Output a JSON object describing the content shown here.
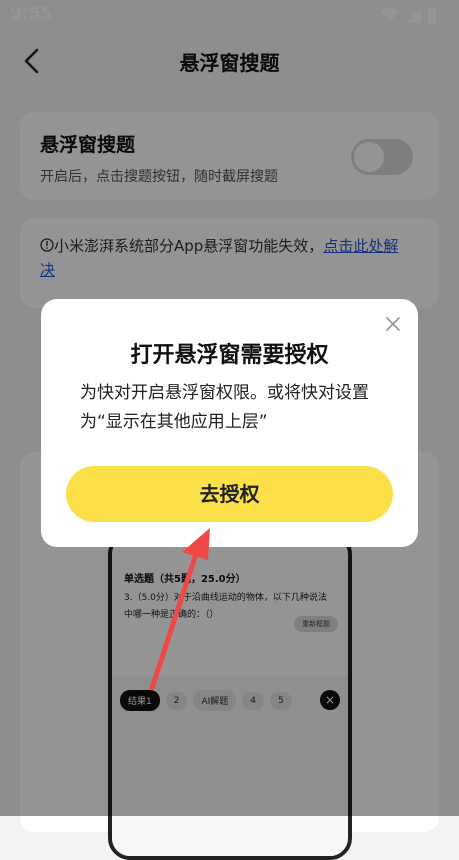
{
  "status": {
    "time": "9:55"
  },
  "header": {
    "title": "悬浮窗搜题"
  },
  "float_card": {
    "title": "悬浮窗搜题",
    "subtitle": "开启后，点击搜题按钮，随时截屏搜题",
    "enabled": false
  },
  "notice": {
    "text": "小米澎湃系统部分App悬浮窗功能失效，",
    "link": "点击此处解决"
  },
  "preview": {
    "heading": "单选题（共5题，25.0分）",
    "question": "3.（5.0分）对于沿曲线运动的物体，以下几种说法中哪一种是正确的：（）",
    "recapture": "重新框题",
    "tabs": [
      "结果1",
      "2",
      "AI解题",
      "4",
      "5"
    ]
  },
  "dialog": {
    "title": "打开悬浮窗需要授权",
    "text": "为快对开启悬浮窗权限。或将快对设置为“显示在其他应用上层”",
    "button": "去授权"
  },
  "colors": {
    "accent": "#fbe04a",
    "link": "#2a55d6",
    "arrow": "#f04848"
  }
}
